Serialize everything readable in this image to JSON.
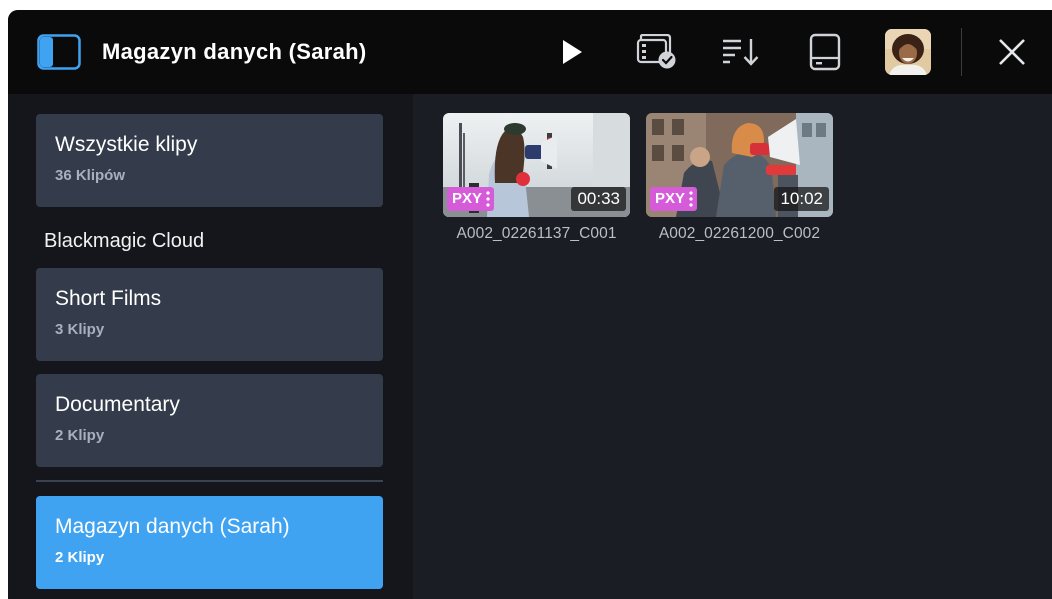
{
  "header": {
    "title": "Magazyn danych (Sarah)",
    "icons": [
      "sidebar-toggle-icon",
      "play-icon",
      "clip-check-icon",
      "sort-icon",
      "drive-icon",
      "user-avatar",
      "close-icon"
    ]
  },
  "sidebar": {
    "all_clips": {
      "name": "Wszystkie klipy",
      "count": "36 Klipów"
    },
    "cloud_section": "Blackmagic Cloud",
    "projects": [
      {
        "name": "Short Films",
        "count": "3 Klipy"
      },
      {
        "name": "Documentary",
        "count": "2 Klipy"
      }
    ],
    "local": {
      "name": "Magazyn danych (Sarah)",
      "count": "2 Klipy"
    }
  },
  "clips": [
    {
      "name": "A002_02261137_C001",
      "badge": "PXY",
      "duration": "00:33"
    },
    {
      "name": "A002_02261200_C002",
      "badge": "PXY",
      "duration": "10:02"
    }
  ],
  "colors": {
    "accent": "#3fa3f2",
    "proxy_badge": "#d65bd9",
    "header_bg": "#0a0a0b",
    "sidebar_bg": "#14161b",
    "card_bg": "#343c4b"
  }
}
